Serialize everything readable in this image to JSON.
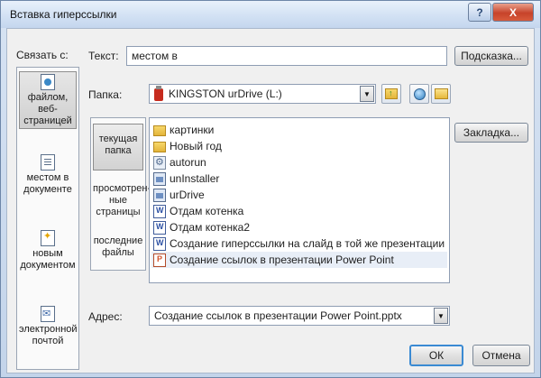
{
  "window": {
    "title": "Вставка гиперссылки",
    "help_label": "?",
    "close_label": "X"
  },
  "link_to": {
    "label": "Связать с:",
    "items": [
      {
        "label_1": "файлом, веб-",
        "label_2": "страницей",
        "icon": "web-page-file-icon",
        "active": true
      },
      {
        "label_1": "местом в",
        "label_2": "документе",
        "icon": "document-place-icon",
        "active": false
      },
      {
        "label_1": "новым",
        "label_2": "документом",
        "icon": "new-document-icon",
        "active": false
      },
      {
        "label_1": "электронной",
        "label_2": "почтой",
        "icon": "email-icon",
        "active": false
      }
    ]
  },
  "text_field": {
    "label": "Текст:",
    "value": "местом в"
  },
  "hint_button": "Подсказка...",
  "folder": {
    "label": "Папка:",
    "value": "KINGSTON urDrive (L:)",
    "icon": "usb-drive-icon"
  },
  "toolbar_icons": [
    "folder-up-icon",
    "web-search-icon",
    "open-folder-icon"
  ],
  "bookmark_button": "Закладка...",
  "look_in": [
    {
      "label_1": "текущая",
      "label_2": "папка",
      "active": true
    },
    {
      "label_1": "просмотрен-",
      "label_2": "ные",
      "label_3": "страницы",
      "active": false
    },
    {
      "label_1": "последние",
      "label_2": "файлы",
      "active": false
    }
  ],
  "files": [
    {
      "name": "картинки",
      "icon": "folder-icon"
    },
    {
      "name": "Новый год",
      "icon": "folder-icon"
    },
    {
      "name": "autorun",
      "icon": "settings-file-icon"
    },
    {
      "name": "unInstaller",
      "icon": "application-icon"
    },
    {
      "name": "urDrive",
      "icon": "application-icon"
    },
    {
      "name": "Отдам котенка",
      "icon": "word-document-icon"
    },
    {
      "name": "Отдам котенка2",
      "icon": "word-document-icon"
    },
    {
      "name": "Создание гиперссылки на слайд в той же презентации",
      "icon": "word-document-icon"
    },
    {
      "name": "Создание ссылок в презентации Power Point",
      "icon": "powerpoint-icon",
      "selected": true
    }
  ],
  "address": {
    "label": "Адрес:",
    "value": "Создание ссылок в презентации Power Point.pptx"
  },
  "ok_button": "ОК",
  "cancel_button": "Отмена"
}
